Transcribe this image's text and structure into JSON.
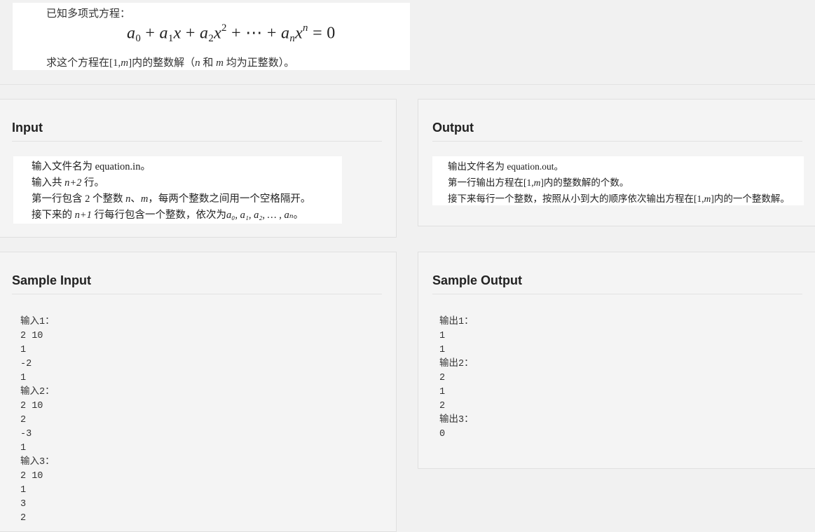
{
  "description": {
    "line1": "已知多项式方程：",
    "formula": {
      "a": "a",
      "x": "x",
      "n": "n",
      "sub0": "0",
      "sub1": "1",
      "sub2": "2",
      "subn": "n",
      "exp2": "2",
      "plus": "+",
      "dots": "⋯",
      "equals": "=",
      "zero": "0"
    },
    "line3": {
      "prefix": "求这个方程在[1,",
      "m": "m",
      "mid": "]内的整数解（",
      "n": "n",
      "and": " 和 ",
      "m2": "m",
      "suffix": " 均为正整数）。"
    }
  },
  "input_panel": {
    "title": "Input",
    "line1": "输入文件名为 equation.in。",
    "line2": {
      "prefix": "输入共 ",
      "var": "n+2",
      "suffix": " 行。"
    },
    "line3": {
      "prefix": "第一行包含 2 个整数 ",
      "n": "n",
      "sep": "、",
      "m": "m",
      "suffix": "，每两个整数之间用一个空格隔开。"
    },
    "line4": {
      "prefix": "接下来的 ",
      "var": "n+1",
      "mid": " 行每行包含一个整数，依次为",
      "seq": "a₀, a₁, a₂, … , aₙ",
      "suffix": "。"
    }
  },
  "output_panel": {
    "title": "Output",
    "line1": "输出文件名为 equation.out。",
    "line2": {
      "prefix": "第一行输出方程在[1,",
      "m": "m",
      "suffix": "]内的整数解的个数。"
    },
    "line3": {
      "prefix": "接下来每行一个整数，按照从小到大的顺序依次输出方程在[1,",
      "m": "m",
      "suffix": "]内的一个整数解。"
    }
  },
  "sample_input": {
    "title": "Sample Input",
    "text": "输入1：\n2 10\n1\n-2\n1\n输入2：\n2 10\n2\n-3\n1\n输入3：\n2 10\n1\n3\n2"
  },
  "sample_output": {
    "title": "Sample Output",
    "text": "输出1：\n1\n1\n输出2：\n2\n1\n2\n输出3：\n0"
  }
}
